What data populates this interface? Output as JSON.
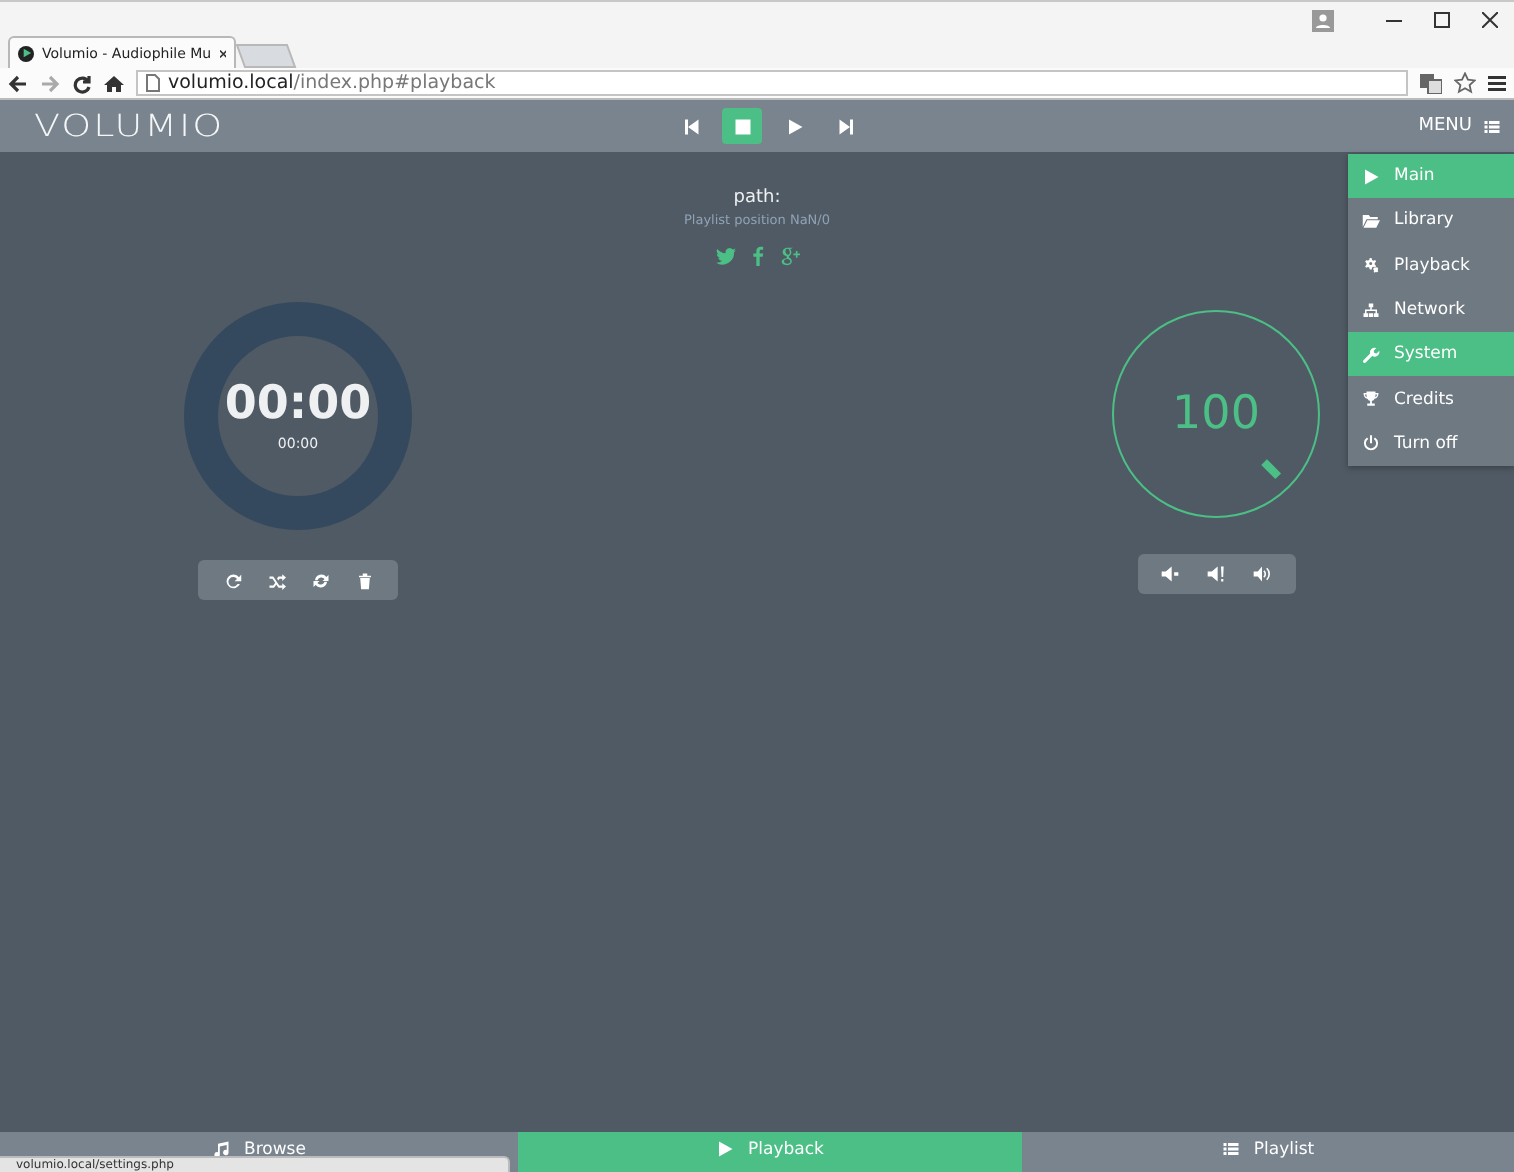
{
  "browser": {
    "tab_title": "Volumio - Audiophile Mu",
    "address_host": "volumio.local",
    "address_path": "/index.php#playback",
    "status_url": "volumio.local/settings.php"
  },
  "header": {
    "logo": "VOLUMIO",
    "menu_label": "MENU"
  },
  "transport": [
    {
      "kind": "previous",
      "selected": false
    },
    {
      "kind": "stop",
      "selected": true
    },
    {
      "kind": "play",
      "selected": false
    },
    {
      "kind": "next",
      "selected": false
    }
  ],
  "now_playing": {
    "path": "path:",
    "position": "Playlist position NaN/0"
  },
  "share": [
    {
      "kind": "twitter"
    },
    {
      "kind": "facebook"
    },
    {
      "kind": "google-plus"
    }
  ],
  "timer": {
    "elapsed": "00:00",
    "total": "00:00"
  },
  "playback_controls": [
    {
      "kind": "repeat"
    },
    {
      "kind": "random"
    },
    {
      "kind": "consume"
    },
    {
      "kind": "clear"
    }
  ],
  "volume": {
    "reading": "100"
  },
  "volume_controls": [
    {
      "kind": "down"
    },
    {
      "kind": "mute"
    },
    {
      "kind": "up"
    }
  ],
  "menu": [
    {
      "label": "Main",
      "kind": "play",
      "selected": true
    },
    {
      "label": "Library",
      "kind": "folder",
      "selected": false
    },
    {
      "label": "Playback",
      "kind": "cogs",
      "selected": false
    },
    {
      "label": "Network",
      "kind": "sitemap",
      "selected": false
    },
    {
      "label": "System",
      "kind": "wrench",
      "selected": true
    },
    {
      "label": "Credits",
      "kind": "trophy",
      "selected": false
    },
    {
      "label": "Turn off",
      "kind": "power",
      "selected": false
    }
  ],
  "bottom_nav": [
    {
      "label": "Browse",
      "kind": "music",
      "selected": false
    },
    {
      "label": "Playback",
      "kind": "play",
      "selected": true
    },
    {
      "label": "Playlist",
      "kind": "list",
      "selected": false
    }
  ]
}
